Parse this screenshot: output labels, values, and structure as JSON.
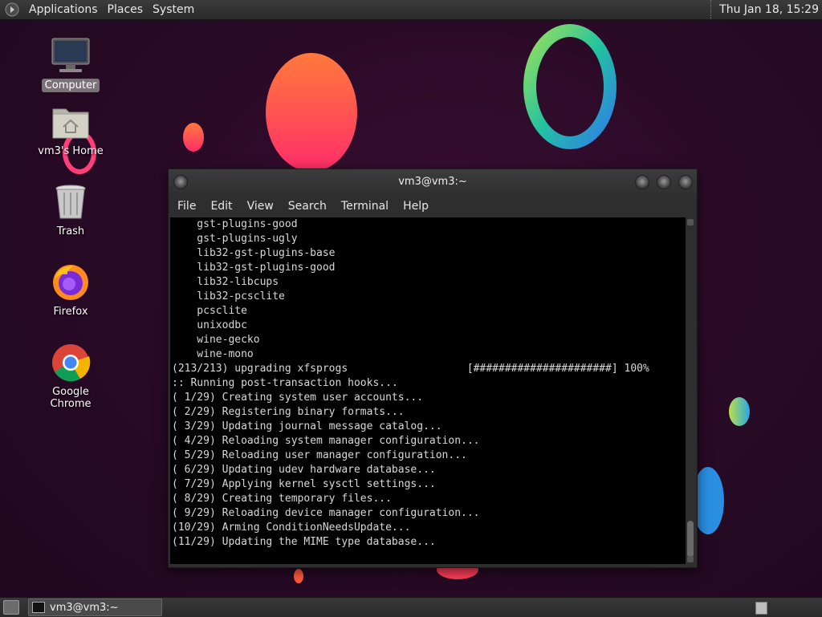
{
  "top_panel": {
    "menus": [
      "Applications",
      "Places",
      "System"
    ],
    "clock": "Thu Jan 18, 15:29"
  },
  "desktop": {
    "icons": [
      {
        "label": "Computer",
        "icon": "computer-icon",
        "selected": true
      },
      {
        "label": "vm3's Home",
        "icon": "home-folder-icon",
        "selected": false
      },
      {
        "label": "Trash",
        "icon": "trash-icon",
        "selected": false
      },
      {
        "label": "Firefox",
        "icon": "firefox-icon",
        "selected": false
      },
      {
        "label": "Google Chrome",
        "icon": "chrome-icon",
        "selected": false
      }
    ]
  },
  "terminal": {
    "title": "vm3@vm3:~",
    "menu": [
      "File",
      "Edit",
      "View",
      "Search",
      "Terminal",
      "Help"
    ],
    "lines": [
      "    gst-plugins-good",
      "    gst-plugins-ugly",
      "    lib32-gst-plugins-base",
      "    lib32-gst-plugins-good",
      "    lib32-libcups",
      "    lib32-pcsclite",
      "    pcsclite",
      "    unixodbc",
      "    wine-gecko",
      "    wine-mono",
      "(213/213) upgrading xfsprogs                   [######################] 100%",
      ":: Running post-transaction hooks...",
      "( 1/29) Creating system user accounts...",
      "( 2/29) Registering binary formats...",
      "( 3/29) Updating journal message catalog...",
      "( 4/29) Reloading system manager configuration...",
      "( 5/29) Reloading user manager configuration...",
      "( 6/29) Updating udev hardware database...",
      "( 7/29) Applying kernel sysctl settings...",
      "( 8/29) Creating temporary files...",
      "( 9/29) Reloading device manager configuration...",
      "(10/29) Arming ConditionNeedsUpdate...",
      "(11/29) Updating the MIME type database..."
    ]
  },
  "bottom_panel": {
    "task_label": "vm3@vm3:~"
  },
  "colors": {
    "background": "#2a0a27",
    "terminal_bg": "#000000",
    "terminal_fg": "#d8d8d8",
    "panel": "#2e2e2e"
  }
}
